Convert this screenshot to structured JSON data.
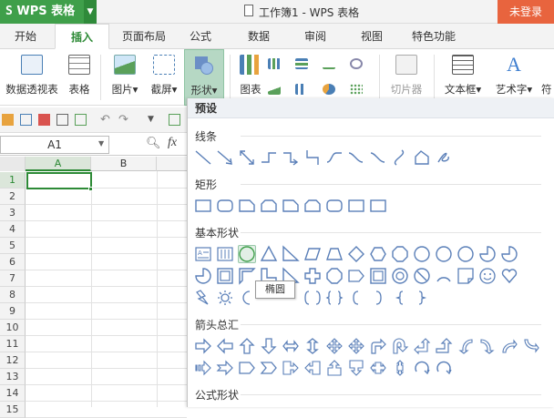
{
  "app": {
    "logo": "S",
    "name": "WPS 表格"
  },
  "title_bar": {
    "doc_title": "工作簿1 - WPS 表格",
    "login": "未登录"
  },
  "tabs": [
    "开始",
    "插入",
    "页面布局",
    "公式",
    "数据",
    "审阅",
    "视图",
    "特色功能"
  ],
  "active_tab": "插入",
  "ribbon": {
    "pivot": "数据透视表",
    "table": "表格",
    "picture": "图片",
    "screenshot": "截屏",
    "shapes": "形状",
    "chart": "图表",
    "slicer": "切片器",
    "textbox": "文本框",
    "wordart": "艺术字",
    "symbol": "符"
  },
  "formula_bar": {
    "cell_ref": "A1",
    "fx": "fx"
  },
  "sheet": {
    "columns": [
      "A",
      "B"
    ],
    "rows": [
      "1",
      "2",
      "3",
      "4",
      "5",
      "6",
      "7",
      "8",
      "9",
      "10",
      "11",
      "12",
      "13",
      "14",
      "15"
    ]
  },
  "shape_panel": {
    "preset": "预设",
    "categories": {
      "lines": "线条",
      "rect": "矩形",
      "basic": "基本形状",
      "arrows": "箭头总汇",
      "formula": "公式形状"
    },
    "tooltip": "椭圆"
  },
  "colors": {
    "brand_green": "#3f9f4a",
    "login_orange": "#e8643e",
    "selection": "#2d8a36"
  }
}
